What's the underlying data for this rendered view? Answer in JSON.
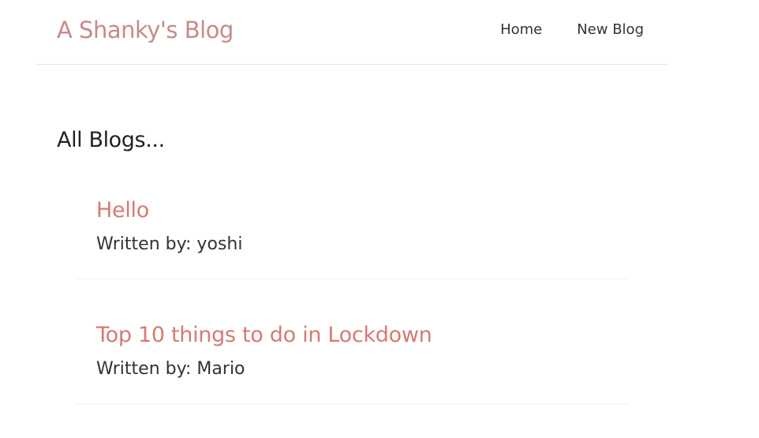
{
  "navbar": {
    "brand": "A Shanky's Blog",
    "links": [
      {
        "label": "Home"
      },
      {
        "label": "New Blog"
      }
    ]
  },
  "main": {
    "heading": "All Blogs...",
    "blogs": [
      {
        "title": "Hello",
        "author_line": "Written by: yoshi"
      },
      {
        "title": "Top 10 things to do in Lockdown",
        "author_line": "Written by: Mario"
      }
    ]
  },
  "colors": {
    "brand": "#c88a8a",
    "blog_title": "#d67a72",
    "text": "#333333",
    "divider": "#e6e6e6"
  }
}
